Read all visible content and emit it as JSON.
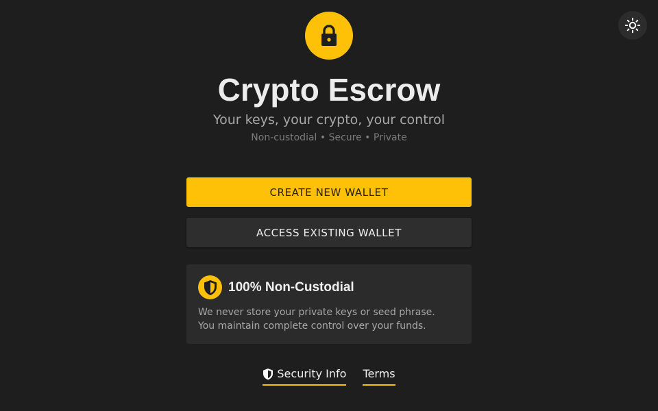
{
  "app": {
    "title": "Crypto Escrow",
    "subtitle": "Your keys, your crypto, your control",
    "tagline": "Non-custodial • Secure • Private",
    "logo_icon": "lock-icon",
    "theme_toggle_icon": "sun-icon"
  },
  "actions": {
    "create_label": "CREATE NEW WALLET",
    "access_label": "ACCESS EXISTING WALLET"
  },
  "info_card": {
    "icon": "shield-icon",
    "title": "100% Non-Custodial",
    "line1": "We never store your private keys or seed phrase.",
    "line2": "You maintain complete control over your funds."
  },
  "footer": {
    "security_label": "Security Info",
    "security_icon": "shield-icon",
    "terms_label": "Terms"
  },
  "colors": {
    "accent": "#ffc107",
    "background": "#1e1e1e",
    "card": "#2b2b2b"
  }
}
